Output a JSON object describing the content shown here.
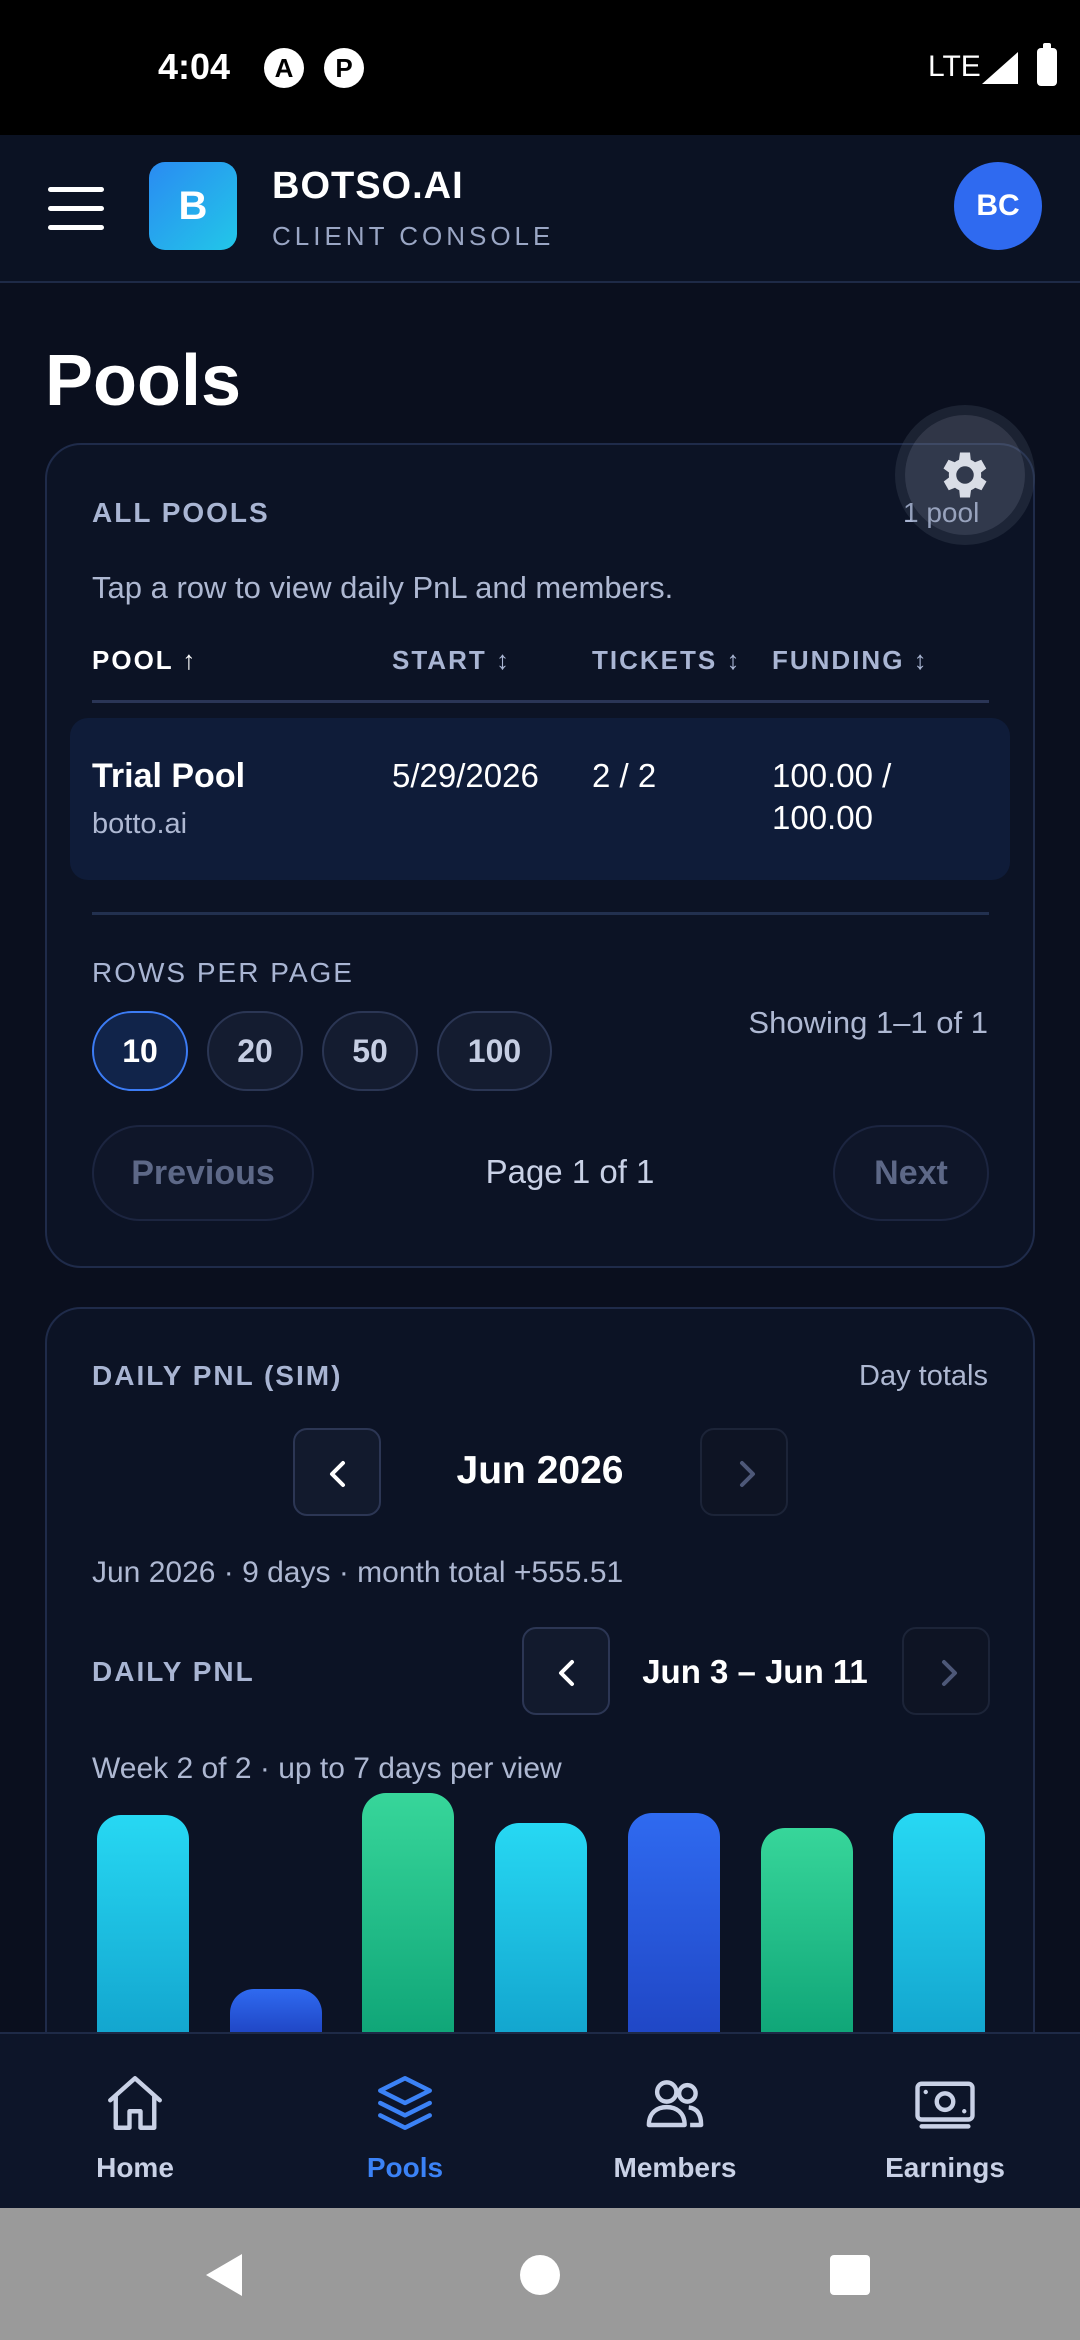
{
  "status_bar": {
    "time": "4:04",
    "network": "LTE",
    "badge_a": "A",
    "badge_b": "P"
  },
  "header": {
    "logo_letter": "B",
    "brand_name": "BOTSO.AI",
    "brand_sub": "CLIENT CONSOLE",
    "avatar_initials": "BC",
    "menu_icon": "hamburger-icon"
  },
  "page": {
    "title": "Pools"
  },
  "pools_card": {
    "heading": "ALL POOLS",
    "count": "1 pool",
    "hint": "Tap a row to view daily PnL and members.",
    "settings_icon": "gear-icon",
    "columns": [
      "POOL ↑",
      "START ↕",
      "TICKETS ↕",
      "FUNDING ↕"
    ],
    "rows": [
      {
        "pool": "Trial Pool",
        "domain": "botto.ai",
        "start": "5/29/2026",
        "tickets": "2 / 2",
        "funding_1": "100.00 /",
        "funding_2": "100.00"
      }
    ],
    "rows_per_page_label": "ROWS PER PAGE",
    "rows_per_page_options": [
      "10",
      "20",
      "50",
      "100"
    ],
    "rows_per_page_selected": "10",
    "showing": "Showing 1–1 of 1",
    "previous": "Previous",
    "page_info": "Page 1 of 1",
    "next": "Next"
  },
  "pnl_card": {
    "heading": "DAILY PNL (SIM)",
    "mode": "Day totals",
    "month": "Jun 2026",
    "summary": "Jun 2026 · 9 days · month total +555.51",
    "sub_heading": "DAILY PNL",
    "range": "Jun 3 – Jun 11",
    "week_info": "Week 2 of 2 · up to 7 days per view",
    "colors": {
      "cyan": "#22d3ee",
      "blue": "#2f6af0",
      "green": "#2ecc8f"
    }
  },
  "chart_data": {
    "type": "bar",
    "note_colors": [
      "cyan",
      "blue",
      "green",
      "cyan",
      "blue",
      "green",
      "cyan"
    ],
    "values_relative": [
      0.86,
      0.17,
      0.95,
      0.83,
      0.87,
      0.81,
      0.87
    ]
  },
  "bottom_nav": {
    "items": [
      {
        "label": "Home",
        "icon": "home-icon"
      },
      {
        "label": "Pools",
        "icon": "layers-icon"
      },
      {
        "label": "Members",
        "icon": "users-icon"
      },
      {
        "label": "Earnings",
        "icon": "cash-icon"
      }
    ],
    "active": "Pools"
  },
  "system_nav": {
    "back": "back-icon",
    "home": "home-circle-icon",
    "recents": "recents-icon"
  }
}
